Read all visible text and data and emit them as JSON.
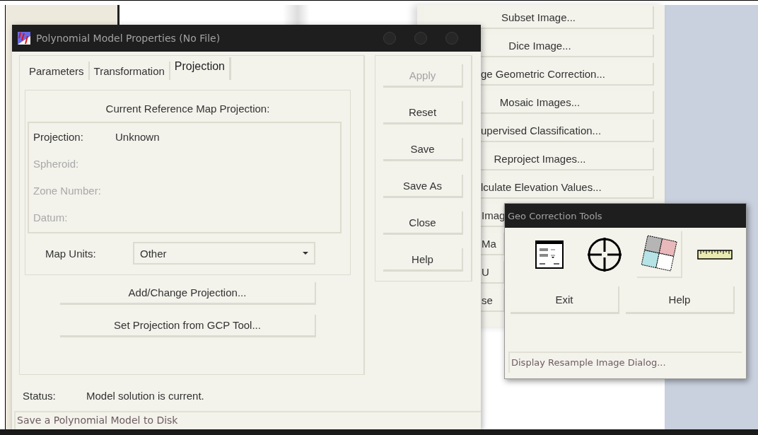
{
  "background_menu": {
    "items": [
      {
        "label": "Subset Image...",
        "kind": "full"
      },
      {
        "label": "Dice Image...",
        "kind": "clipped_left"
      },
      {
        "label": "ge Geometric Correction...",
        "kind": "clipped_left"
      },
      {
        "label": "Mosaic Images...",
        "kind": "clipped_left"
      },
      {
        "label": "upervised Classification...",
        "kind": "clipped_left"
      },
      {
        "label": "Reproject Images...",
        "kind": "clipped_left"
      },
      {
        "label": "lculate Elevation Values...",
        "kind": "clipped_left"
      },
      {
        "label": "Imag",
        "kind": "clipped_both"
      },
      {
        "label": "Ma",
        "kind": "clipped_both"
      },
      {
        "label": "U",
        "kind": "clipped_both"
      },
      {
        "label": "se",
        "kind": "clipped_both"
      }
    ]
  },
  "dialog": {
    "title": "Polynomial Model Properties (No File)",
    "tabs": [
      {
        "label": "Parameters",
        "selected": false
      },
      {
        "label": "Transformation",
        "selected": false
      },
      {
        "label": "Projection",
        "selected": true
      }
    ],
    "group_title": "Current Reference Map Projection:",
    "fields": [
      {
        "label": "Projection:",
        "value": "Unknown",
        "disabled": false
      },
      {
        "label": "Spheroid:",
        "disabled": true
      },
      {
        "label": "Zone Number:",
        "disabled": true
      },
      {
        "label": "Datum:",
        "disabled": true
      }
    ],
    "map_units": {
      "label": "Map Units:",
      "value": "Other"
    },
    "actions": [
      "Add/Change Projection...",
      "Set Projection from GCP Tool..."
    ],
    "buttons": [
      {
        "label": "Apply",
        "disabled": true
      },
      {
        "label": "Reset",
        "disabled": false
      },
      {
        "label": "Save",
        "disabled": false
      },
      {
        "label": "Save As",
        "disabled": false
      },
      {
        "label": "Close",
        "disabled": false
      },
      {
        "label": "Help",
        "disabled": false
      }
    ],
    "status": {
      "label": "Status:",
      "value": "Model solution is current."
    },
    "status_bar": "Save a Polynomial Model to Disk"
  },
  "geo_tools": {
    "title": "Geo Correction Tools",
    "tools": [
      {
        "kind": "form"
      },
      {
        "kind": "crosshair"
      },
      {
        "kind": "tiles"
      },
      {
        "kind": "ruler"
      }
    ],
    "buttons": [
      "Exit",
      "Help"
    ],
    "status_bar": "Display Resample Image Dialog..."
  }
}
